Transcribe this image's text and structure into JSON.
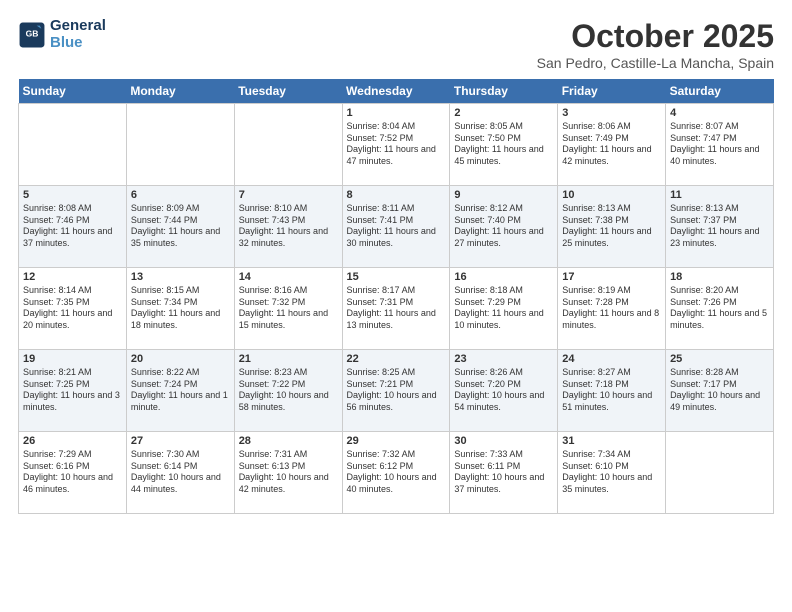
{
  "logo": {
    "line1": "General",
    "line2": "Blue"
  },
  "title": "October 2025",
  "location": "San Pedro, Castille-La Mancha, Spain",
  "days": [
    "Sunday",
    "Monday",
    "Tuesday",
    "Wednesday",
    "Thursday",
    "Friday",
    "Saturday"
  ],
  "weeks": [
    [
      {
        "date": "",
        "text": ""
      },
      {
        "date": "",
        "text": ""
      },
      {
        "date": "",
        "text": ""
      },
      {
        "date": "1",
        "text": "Sunrise: 8:04 AM\nSunset: 7:52 PM\nDaylight: 11 hours and 47 minutes."
      },
      {
        "date": "2",
        "text": "Sunrise: 8:05 AM\nSunset: 7:50 PM\nDaylight: 11 hours and 45 minutes."
      },
      {
        "date": "3",
        "text": "Sunrise: 8:06 AM\nSunset: 7:49 PM\nDaylight: 11 hours and 42 minutes."
      },
      {
        "date": "4",
        "text": "Sunrise: 8:07 AM\nSunset: 7:47 PM\nDaylight: 11 hours and 40 minutes."
      }
    ],
    [
      {
        "date": "5",
        "text": "Sunrise: 8:08 AM\nSunset: 7:46 PM\nDaylight: 11 hours and 37 minutes."
      },
      {
        "date": "6",
        "text": "Sunrise: 8:09 AM\nSunset: 7:44 PM\nDaylight: 11 hours and 35 minutes."
      },
      {
        "date": "7",
        "text": "Sunrise: 8:10 AM\nSunset: 7:43 PM\nDaylight: 11 hours and 32 minutes."
      },
      {
        "date": "8",
        "text": "Sunrise: 8:11 AM\nSunset: 7:41 PM\nDaylight: 11 hours and 30 minutes."
      },
      {
        "date": "9",
        "text": "Sunrise: 8:12 AM\nSunset: 7:40 PM\nDaylight: 11 hours and 27 minutes."
      },
      {
        "date": "10",
        "text": "Sunrise: 8:13 AM\nSunset: 7:38 PM\nDaylight: 11 hours and 25 minutes."
      },
      {
        "date": "11",
        "text": "Sunrise: 8:13 AM\nSunset: 7:37 PM\nDaylight: 11 hours and 23 minutes."
      }
    ],
    [
      {
        "date": "12",
        "text": "Sunrise: 8:14 AM\nSunset: 7:35 PM\nDaylight: 11 hours and 20 minutes."
      },
      {
        "date": "13",
        "text": "Sunrise: 8:15 AM\nSunset: 7:34 PM\nDaylight: 11 hours and 18 minutes."
      },
      {
        "date": "14",
        "text": "Sunrise: 8:16 AM\nSunset: 7:32 PM\nDaylight: 11 hours and 15 minutes."
      },
      {
        "date": "15",
        "text": "Sunrise: 8:17 AM\nSunset: 7:31 PM\nDaylight: 11 hours and 13 minutes."
      },
      {
        "date": "16",
        "text": "Sunrise: 8:18 AM\nSunset: 7:29 PM\nDaylight: 11 hours and 10 minutes."
      },
      {
        "date": "17",
        "text": "Sunrise: 8:19 AM\nSunset: 7:28 PM\nDaylight: 11 hours and 8 minutes."
      },
      {
        "date": "18",
        "text": "Sunrise: 8:20 AM\nSunset: 7:26 PM\nDaylight: 11 hours and 5 minutes."
      }
    ],
    [
      {
        "date": "19",
        "text": "Sunrise: 8:21 AM\nSunset: 7:25 PM\nDaylight: 11 hours and 3 minutes."
      },
      {
        "date": "20",
        "text": "Sunrise: 8:22 AM\nSunset: 7:24 PM\nDaylight: 11 hours and 1 minute."
      },
      {
        "date": "21",
        "text": "Sunrise: 8:23 AM\nSunset: 7:22 PM\nDaylight: 10 hours and 58 minutes."
      },
      {
        "date": "22",
        "text": "Sunrise: 8:25 AM\nSunset: 7:21 PM\nDaylight: 10 hours and 56 minutes."
      },
      {
        "date": "23",
        "text": "Sunrise: 8:26 AM\nSunset: 7:20 PM\nDaylight: 10 hours and 54 minutes."
      },
      {
        "date": "24",
        "text": "Sunrise: 8:27 AM\nSunset: 7:18 PM\nDaylight: 10 hours and 51 minutes."
      },
      {
        "date": "25",
        "text": "Sunrise: 8:28 AM\nSunset: 7:17 PM\nDaylight: 10 hours and 49 minutes."
      }
    ],
    [
      {
        "date": "26",
        "text": "Sunrise: 7:29 AM\nSunset: 6:16 PM\nDaylight: 10 hours and 46 minutes."
      },
      {
        "date": "27",
        "text": "Sunrise: 7:30 AM\nSunset: 6:14 PM\nDaylight: 10 hours and 44 minutes."
      },
      {
        "date": "28",
        "text": "Sunrise: 7:31 AM\nSunset: 6:13 PM\nDaylight: 10 hours and 42 minutes."
      },
      {
        "date": "29",
        "text": "Sunrise: 7:32 AM\nSunset: 6:12 PM\nDaylight: 10 hours and 40 minutes."
      },
      {
        "date": "30",
        "text": "Sunrise: 7:33 AM\nSunset: 6:11 PM\nDaylight: 10 hours and 37 minutes."
      },
      {
        "date": "31",
        "text": "Sunrise: 7:34 AM\nSunset: 6:10 PM\nDaylight: 10 hours and 35 minutes."
      },
      {
        "date": "",
        "text": ""
      }
    ]
  ]
}
